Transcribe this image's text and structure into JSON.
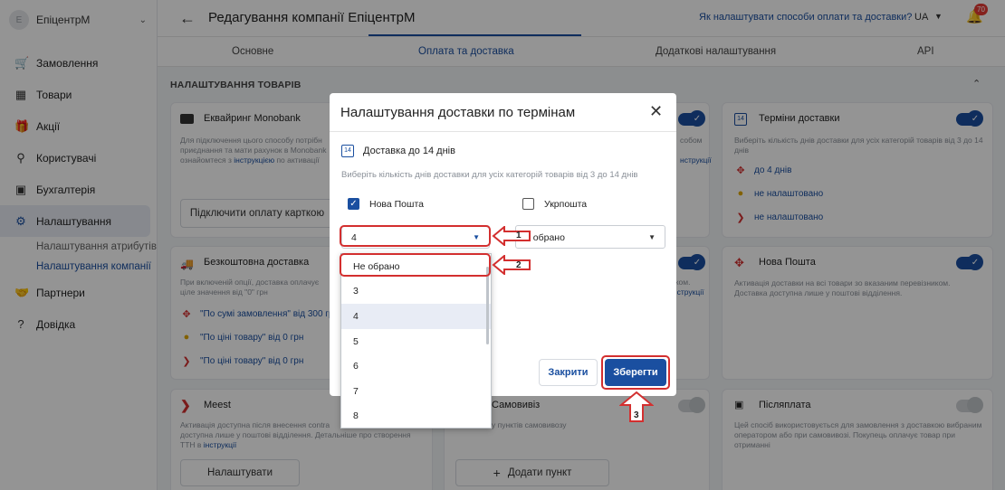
{
  "sidebar": {
    "brand_initial": "Е",
    "brand_name": "ЕпіцентрМ",
    "items": [
      {
        "label": "Замовлення",
        "icon": "cart-icon"
      },
      {
        "label": "Товари",
        "icon": "box-icon"
      },
      {
        "label": "Акції",
        "icon": "gift-icon"
      },
      {
        "label": "Користувачі",
        "icon": "users-icon"
      },
      {
        "label": "Бухгалтерія",
        "icon": "wallet-icon"
      },
      {
        "label": "Налаштування",
        "icon": "gear-icon"
      },
      {
        "label": "Партнери",
        "icon": "handshake-icon"
      },
      {
        "label": "Довідка",
        "icon": "help-icon"
      }
    ],
    "subitems": [
      "Налаштування атрибутів",
      "Налаштування компанії"
    ]
  },
  "header": {
    "title": "Редагування компанії ЕпіцентрМ",
    "help_link": "Як налаштувати способи оплати та доставки?",
    "lang": "UA",
    "notifications": "70"
  },
  "tabs": [
    "Основне",
    "Оплата та доставка",
    "Додаткові налаштування",
    "API"
  ],
  "section_title": "НАЛАШТУВАННЯ ТОВАРІВ",
  "cards": {
    "monobank": {
      "title": "Еквайринг Monobank",
      "desc1": "Для підключення цього способу потрібн",
      "desc2": "приєднання та мати рахунок в Monobank",
      "desc3": "ознайомтеся з",
      "desc_link": "інструкцією",
      "desc4": "по активації",
      "button": "Підключити оплату карткою"
    },
    "free_delivery": {
      "title": "Безкоштовна доставка",
      "desc1": "При включеній опції, доставка оплачує",
      "desc2": "ціле значення від \"0\" грн",
      "rows": [
        "\"По сумі замовлення\" від 300 гр",
        "\"По ціні товару\" від 0 грн",
        "\"По ціні товару\" від 0 грн"
      ]
    },
    "meest": {
      "title": "Meest",
      "desc1": "Активація доступна після внесення contra",
      "desc2": "доступна лише у поштові відділення. Детальніше про створення",
      "desc3": "ТТН в",
      "desc_link": "інструкції",
      "button": "Налаштувати"
    },
    "middle_top": {
      "desc1": "собом",
      "desc_link": "нструкції"
    },
    "middle_mid": {
      "desc1": "оком.",
      "desc_link": "інструкції"
    },
    "pickup": {
      "title": "Самовивіз",
      "desc1": "у пунктів самовивозу",
      "button": "Додати пункт"
    },
    "delivery_terms": {
      "title": "Терміни доставки",
      "desc": "Виберіть кількість днів доставки для усіх категорій товарів від 3 до 14 днів",
      "rows": [
        "до 4 днів",
        "не налаштовано",
        "не налаштовано"
      ]
    },
    "nova_poshta": {
      "title": "Нова Пошта",
      "desc": "Активація доставки на всі товари зо вказаним перевізником. Доставка доступна лише у поштові відділення."
    },
    "cod": {
      "title": "Післяплата",
      "desc": "Цей спосіб використовується для замовлення з доставкою вибраним оператором або при самовивозі. Покупець оплачує товар при отриманні"
    }
  },
  "modal": {
    "title": "Налаштування доставки по термінам",
    "calendar_num": "14",
    "delivery_label": "Доставка до 14 днів",
    "hint": "Виберіть кількість днів доставки для усіх категорій товарів від 3 до 14 днів",
    "carrier1": "Нова Пошта",
    "carrier2": "Укрпошта",
    "select1_value": "4",
    "select2_value": "е обрано",
    "close_button": "Закрити",
    "save_button": "Зберегти"
  },
  "dropdown": {
    "options": [
      "Не обрано",
      "3",
      "4",
      "5",
      "6",
      "7",
      "8"
    ],
    "selected": "4"
  },
  "annotations": [
    "1",
    "2",
    "3"
  ],
  "colors": {
    "accent": "#1a4fa0",
    "annotation": "#d32f2f",
    "badge": "#e53935"
  }
}
